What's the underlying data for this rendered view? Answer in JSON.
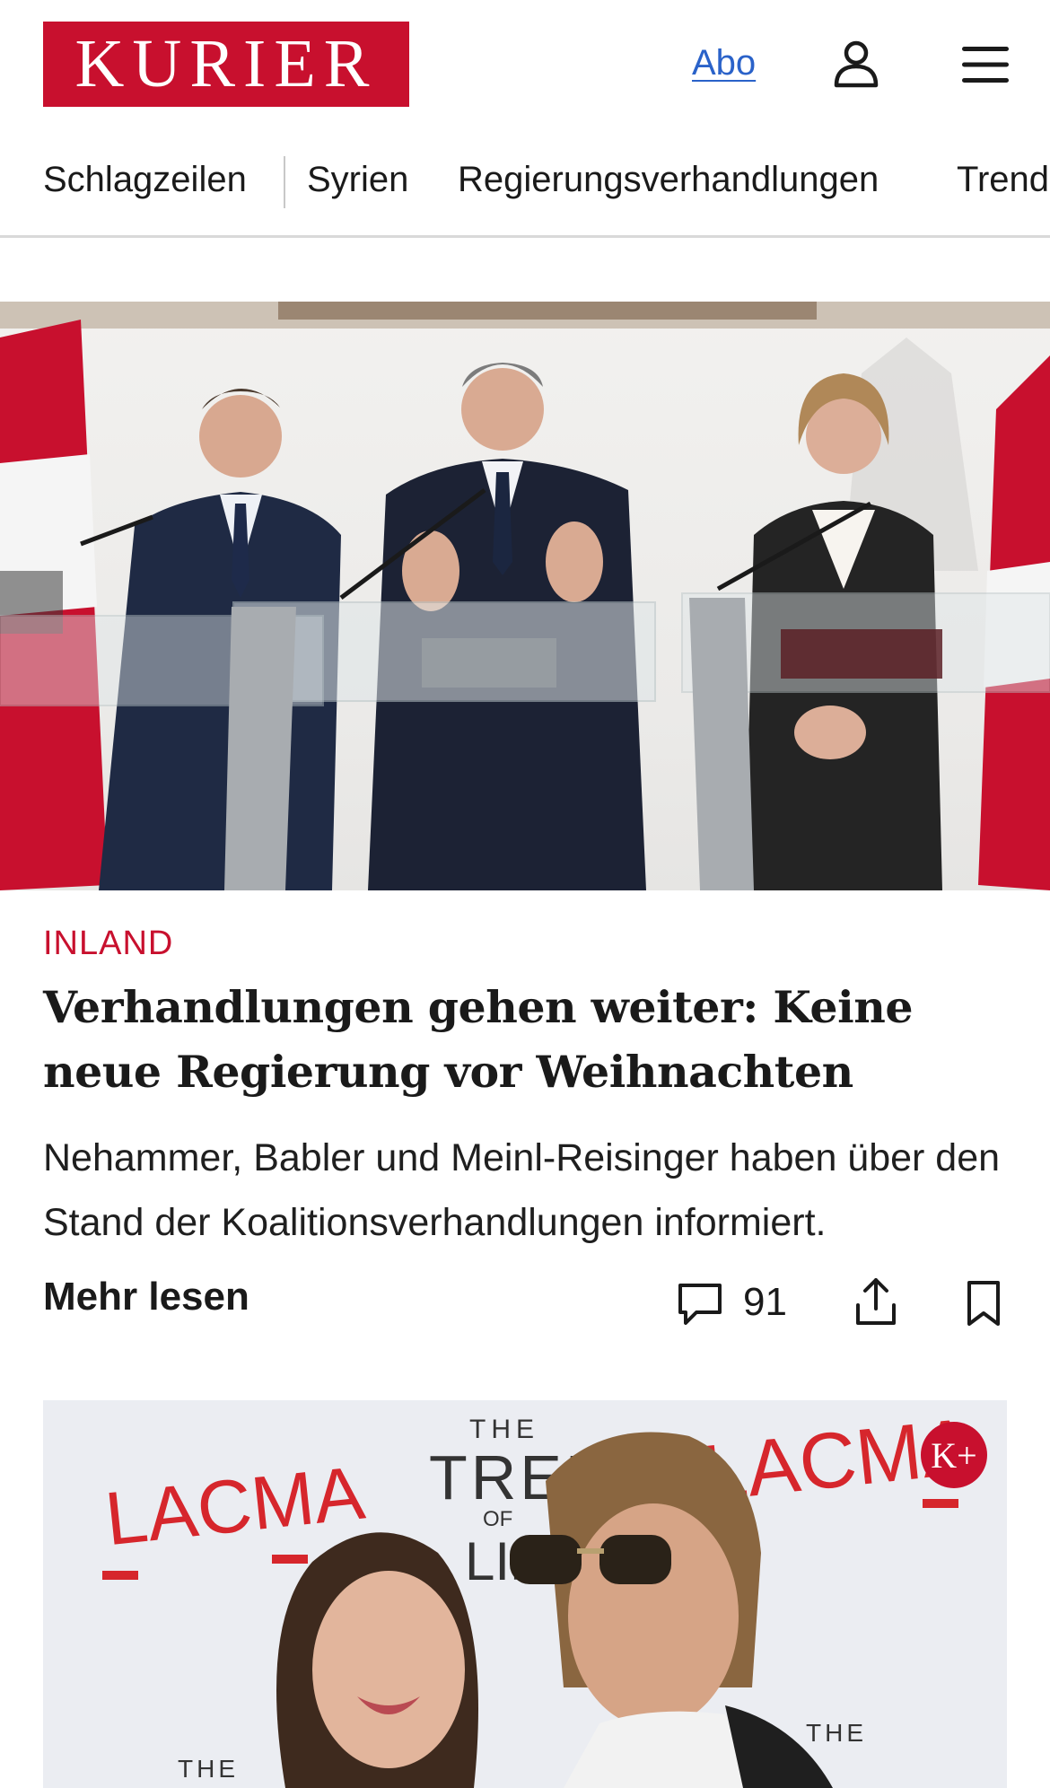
{
  "header": {
    "logo_text": "KURIER",
    "abo_label": "Abo",
    "brand_color": "#c8102e",
    "user_icon": "user-icon",
    "menu_icon": "menu-icon"
  },
  "nav": {
    "items": [
      {
        "label": "Schlagzeilen"
      },
      {
        "label": "Syrien"
      },
      {
        "label": "Regierungsverhandlungen"
      },
      {
        "label": "Trend"
      }
    ]
  },
  "article": {
    "kicker": "INLAND",
    "headline": "Verhandlungen gehen weiter: Keine neue Regierung vor Weihnachten",
    "teaser": "Nehammer, Babler und Meinl-Reisinger haben über den Stand der Koalitionsverhandlungen informiert.",
    "more_label": "Mehr lesen",
    "comment_count": "91",
    "comment_icon": "comment-icon",
    "share_icon": "share-icon",
    "bookmark_icon": "bookmark-icon"
  },
  "second_card": {
    "backdrop_text_left": "LACMA",
    "backdrop_text_right": "LACMA",
    "backdrop_text_tree_1": "THE",
    "backdrop_text_tree_2": "TREE",
    "backdrop_text_tree_3": "OF",
    "backdrop_text_tree_4": "LIFE",
    "backdrop_text_bottom_left": "THE",
    "backdrop_text_bottom_right": "THE",
    "badge_label": "K+"
  }
}
